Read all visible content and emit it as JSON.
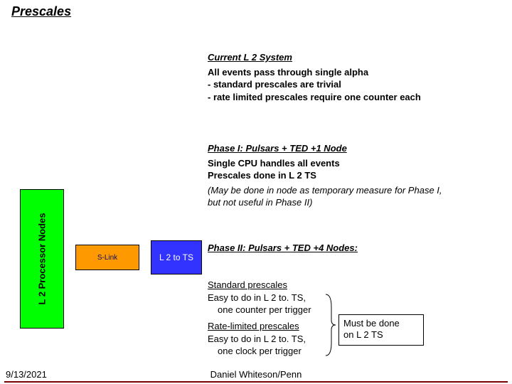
{
  "title": "Prescales",
  "current": {
    "heading": "Current L 2 System",
    "line1": "All events pass through single alpha",
    "line2": "- standard prescales are trivial",
    "line3": "- rate limited prescales require one counter each"
  },
  "phase1": {
    "heading": "Phase I: Pulsars + TED +1 Node",
    "line1": "Single CPU handles all events",
    "line2": "Prescales done in L 2 TS",
    "note1": "(May be done in node as temporary measure for Phase I,",
    "note2": "but not useful in Phase II)"
  },
  "phase2": {
    "heading": "Phase II: Pulsars + TED +4 Nodes:",
    "std_heading": "Standard prescales",
    "std_line1": "Easy to do in L 2 to. TS,",
    "std_line2": "one counter per trigger",
    "rate_heading": "Rate-limited prescales",
    "rate_line1": "Easy to do in L 2 to. TS,",
    "rate_line2": "one clock per trigger"
  },
  "callout": {
    "line1": "Must be done",
    "line2": "on L 2 TS"
  },
  "diagram": {
    "proc_label": "L 2 Processor Nodes",
    "slink_label": "S-Link",
    "l2ts_label": "L 2 to TS"
  },
  "footer": {
    "date": "9/13/2021",
    "author": "Daniel Whiteson/Penn"
  }
}
